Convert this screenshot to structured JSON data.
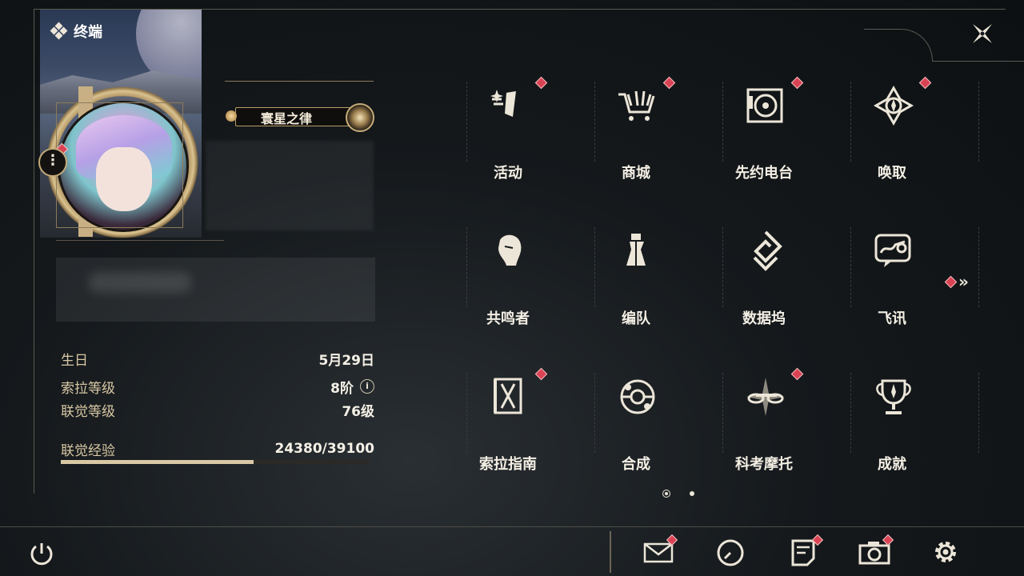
{
  "header": {
    "title": "终端"
  },
  "profile": {
    "title_badge": "寰星之律",
    "stats": [
      {
        "label": "生日",
        "value": "5月29日"
      },
      {
        "label": "索拉等级",
        "value": "8阶"
      },
      {
        "label": "联觉等级",
        "value": "76级"
      }
    ],
    "exp": {
      "label": "联觉经验",
      "value": "24380/39100",
      "current": 24380,
      "max": 39100
    }
  },
  "menu": {
    "items": [
      {
        "label": "活动",
        "icon": "event-icon",
        "badge": true
      },
      {
        "label": "商城",
        "icon": "shop-cart-icon",
        "badge": true
      },
      {
        "label": "先约电台",
        "icon": "radio-icon",
        "badge": true
      },
      {
        "label": "唤取",
        "icon": "convene-icon",
        "badge": true
      },
      {
        "label": "共鸣者",
        "icon": "resonator-icon",
        "badge": false
      },
      {
        "label": "编队",
        "icon": "team-chess-icon",
        "badge": false
      },
      {
        "label": "数据坞",
        "icon": "data-bank-icon",
        "badge": false
      },
      {
        "label": "飞讯",
        "icon": "message-chat-icon",
        "badge": false
      },
      {
        "label": "索拉指南",
        "icon": "guide-book-icon",
        "badge": true
      },
      {
        "label": "合成",
        "icon": "synthesis-icon",
        "badge": false
      },
      {
        "label": "科考摩托",
        "icon": "motorcycle-icon",
        "badge": true
      },
      {
        "label": "成就",
        "icon": "trophy-icon",
        "badge": false
      }
    ],
    "page": 1,
    "page_count": 2
  },
  "colors": {
    "accent_gold": "#c8b084",
    "badge_red": "#d94354",
    "text": "#ece6d8"
  }
}
